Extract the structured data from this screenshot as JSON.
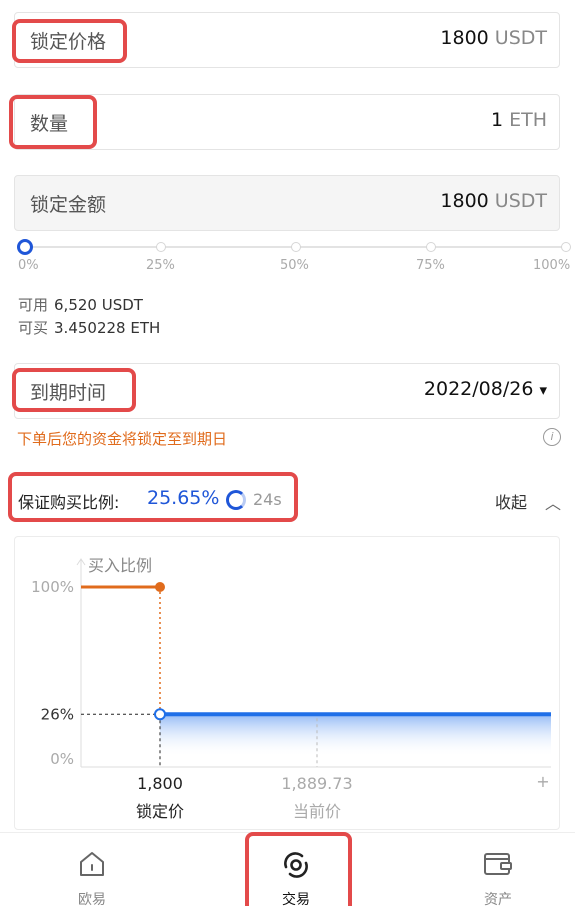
{
  "form": {
    "lock_price": {
      "label": "锁定价格",
      "value": "1800",
      "unit": "USDT"
    },
    "quantity": {
      "label": "数量",
      "value": "1",
      "unit": "ETH"
    },
    "lock_amount": {
      "label": "锁定金额",
      "value": "1800",
      "unit": "USDT"
    }
  },
  "slider": {
    "value_percent": 0,
    "ticks": [
      "0%",
      "25%",
      "50%",
      "75%",
      "100%"
    ]
  },
  "balance": {
    "available_label": "可用",
    "available_value": "6,520 USDT",
    "buyable_label": "可买",
    "buyable_value": "3.450228 ETH"
  },
  "expiry": {
    "label": "到期时间",
    "value": "2022/08/26",
    "arrow": "▾"
  },
  "note": "下单后您的资金将锁定至到期日",
  "ratio": {
    "label": "保证购买比例:",
    "value": "25.65%",
    "countdown": "24s",
    "collapse_label": "收起"
  },
  "chart_data": {
    "type": "line",
    "ylabel": "买入比例",
    "y_ticks": [
      "100%",
      "26%",
      "0%"
    ],
    "x_ticks": [
      {
        "value": "1,800",
        "label": "锁定价"
      },
      {
        "value": "1,889.73",
        "label": "当前价"
      }
    ],
    "x_end_symbol": "+",
    "series": [
      {
        "color": "#e06b1c",
        "points": [
          {
            "x": "0",
            "y": 100
          },
          {
            "x": 1800,
            "y": 100
          }
        ]
      },
      {
        "color": "#1f6fe8",
        "points": [
          {
            "x": 1800,
            "y": 26
          },
          {
            "x": "+",
            "y": 26
          }
        ]
      }
    ]
  },
  "nav": {
    "items": [
      {
        "label": "欧易",
        "icon": "home-icon"
      },
      {
        "label": "交易",
        "icon": "trade-icon"
      },
      {
        "label": "资产",
        "icon": "wallet-icon"
      }
    ]
  },
  "colors": {
    "accent": "#1f56d8",
    "orange": "#e06b1c",
    "highlight": "#e34a4a"
  }
}
